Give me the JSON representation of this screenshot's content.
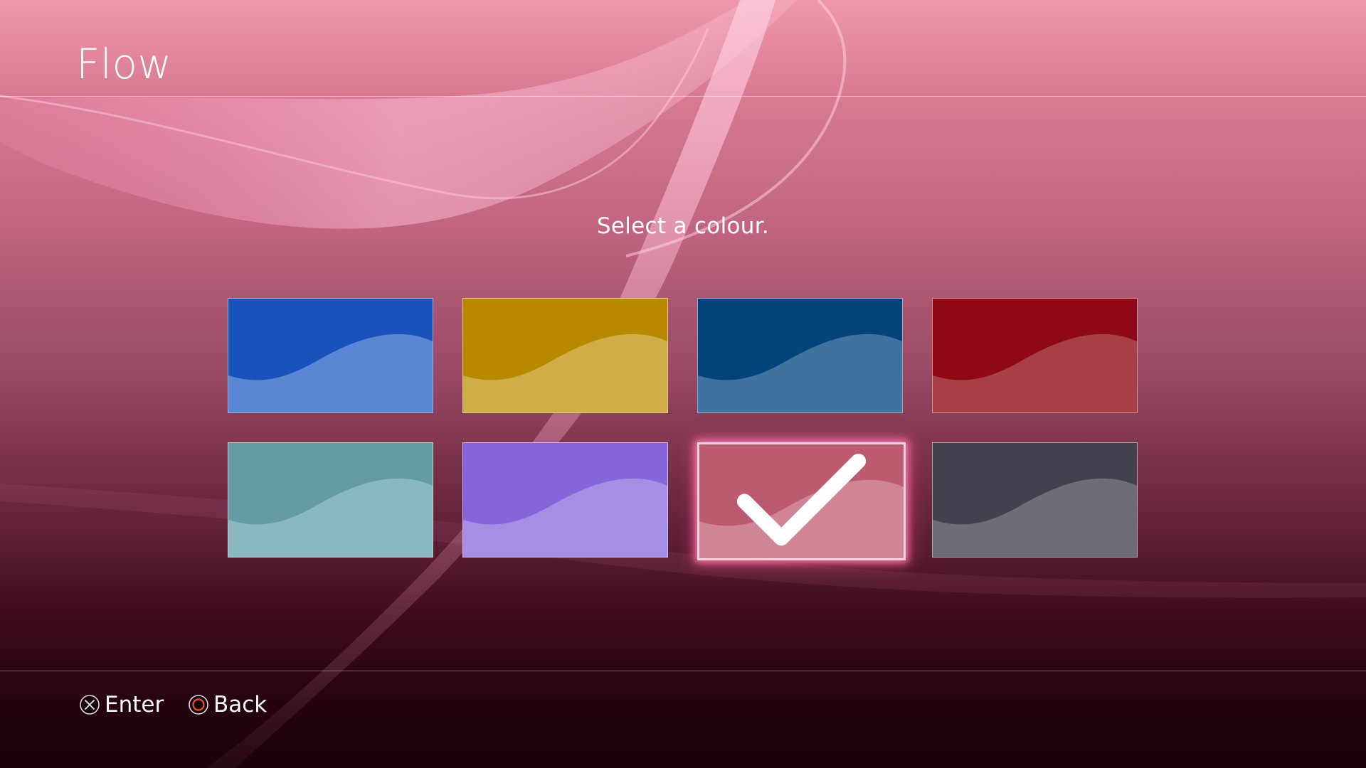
{
  "header": {
    "title": "Flow"
  },
  "prompt": "Select a colour.",
  "swatches": [
    {
      "id": "blue",
      "base": "#1a52bc",
      "light": "#5b86d4",
      "selected": false
    },
    {
      "id": "gold",
      "base": "#b88900",
      "light": "#cfae47",
      "selected": false
    },
    {
      "id": "navy",
      "base": "#04437c",
      "light": "#3f729e",
      "selected": false
    },
    {
      "id": "red",
      "base": "#8f0815",
      "light": "#a83f46",
      "selected": false
    },
    {
      "id": "teal",
      "base": "#6499a6",
      "light": "#8ab8c0",
      "selected": false
    },
    {
      "id": "purple",
      "base": "#8565d9",
      "light": "#a68de6",
      "selected": false
    },
    {
      "id": "pink",
      "base": "#bc5a70",
      "light": "#cf8596",
      "selected": true
    },
    {
      "id": "grey",
      "base": "#43434f",
      "light": "#6d6d78",
      "selected": false
    }
  ],
  "selected_icon": "check-icon",
  "footer": {
    "enter": {
      "icon": "cross-button-icon",
      "label": "Enter"
    },
    "back": {
      "icon": "circle-button-icon",
      "label": "Back"
    }
  },
  "colors": {
    "selection_glow": "#ff78aa",
    "circle_button": "#e8542c"
  }
}
